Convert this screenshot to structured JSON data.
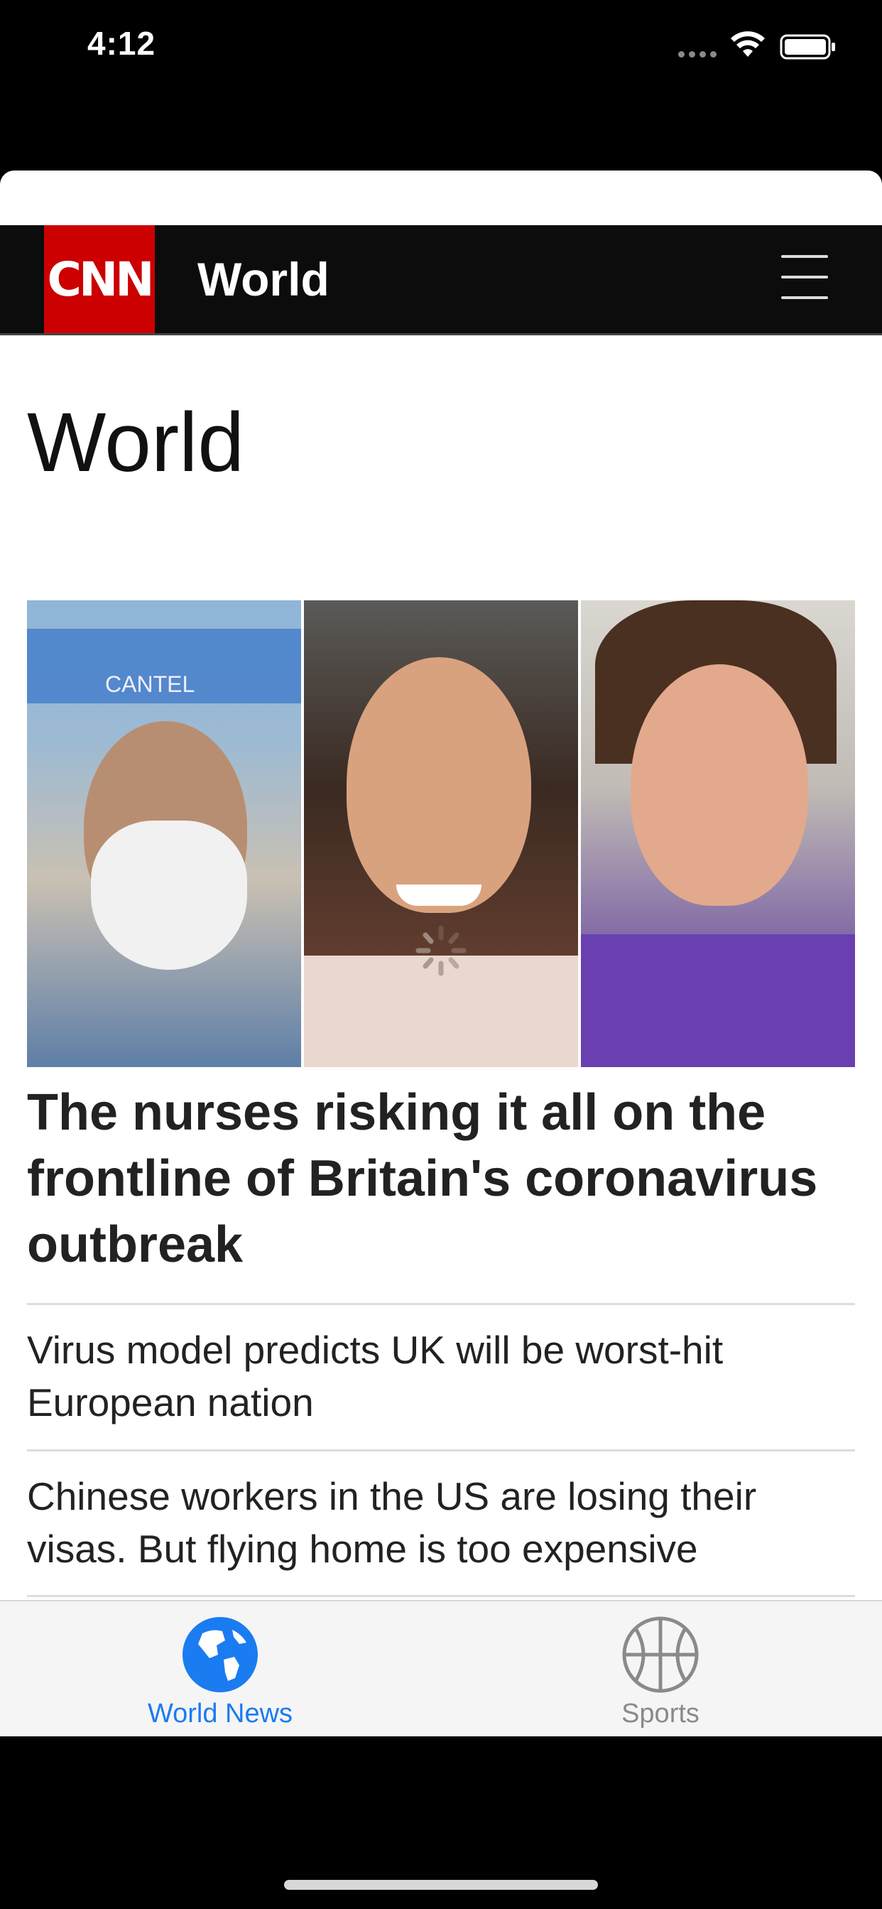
{
  "status_bar": {
    "time": "4:12"
  },
  "header": {
    "logo": "CNN",
    "title": "World"
  },
  "page": {
    "heading": "World"
  },
  "hero": {
    "photo_text": "CANTEL",
    "headline": "The nurses risking it all on the frontline of Britain's coronavirus outbreak"
  },
  "stories": [
    {
      "title": "Virus model predicts UK will be worst-hit European nation"
    },
    {
      "title": "Chinese workers in the US are losing their visas. But flying home is too expensive"
    }
  ],
  "tab_bar": {
    "tabs": [
      {
        "label": "World News",
        "icon": "globe-icon",
        "selected": true
      },
      {
        "label": "Sports",
        "icon": "basketball-icon",
        "selected": false
      }
    ],
    "colors": {
      "selected": "#1a7cf0",
      "unselected": "#8a8a8a"
    }
  }
}
